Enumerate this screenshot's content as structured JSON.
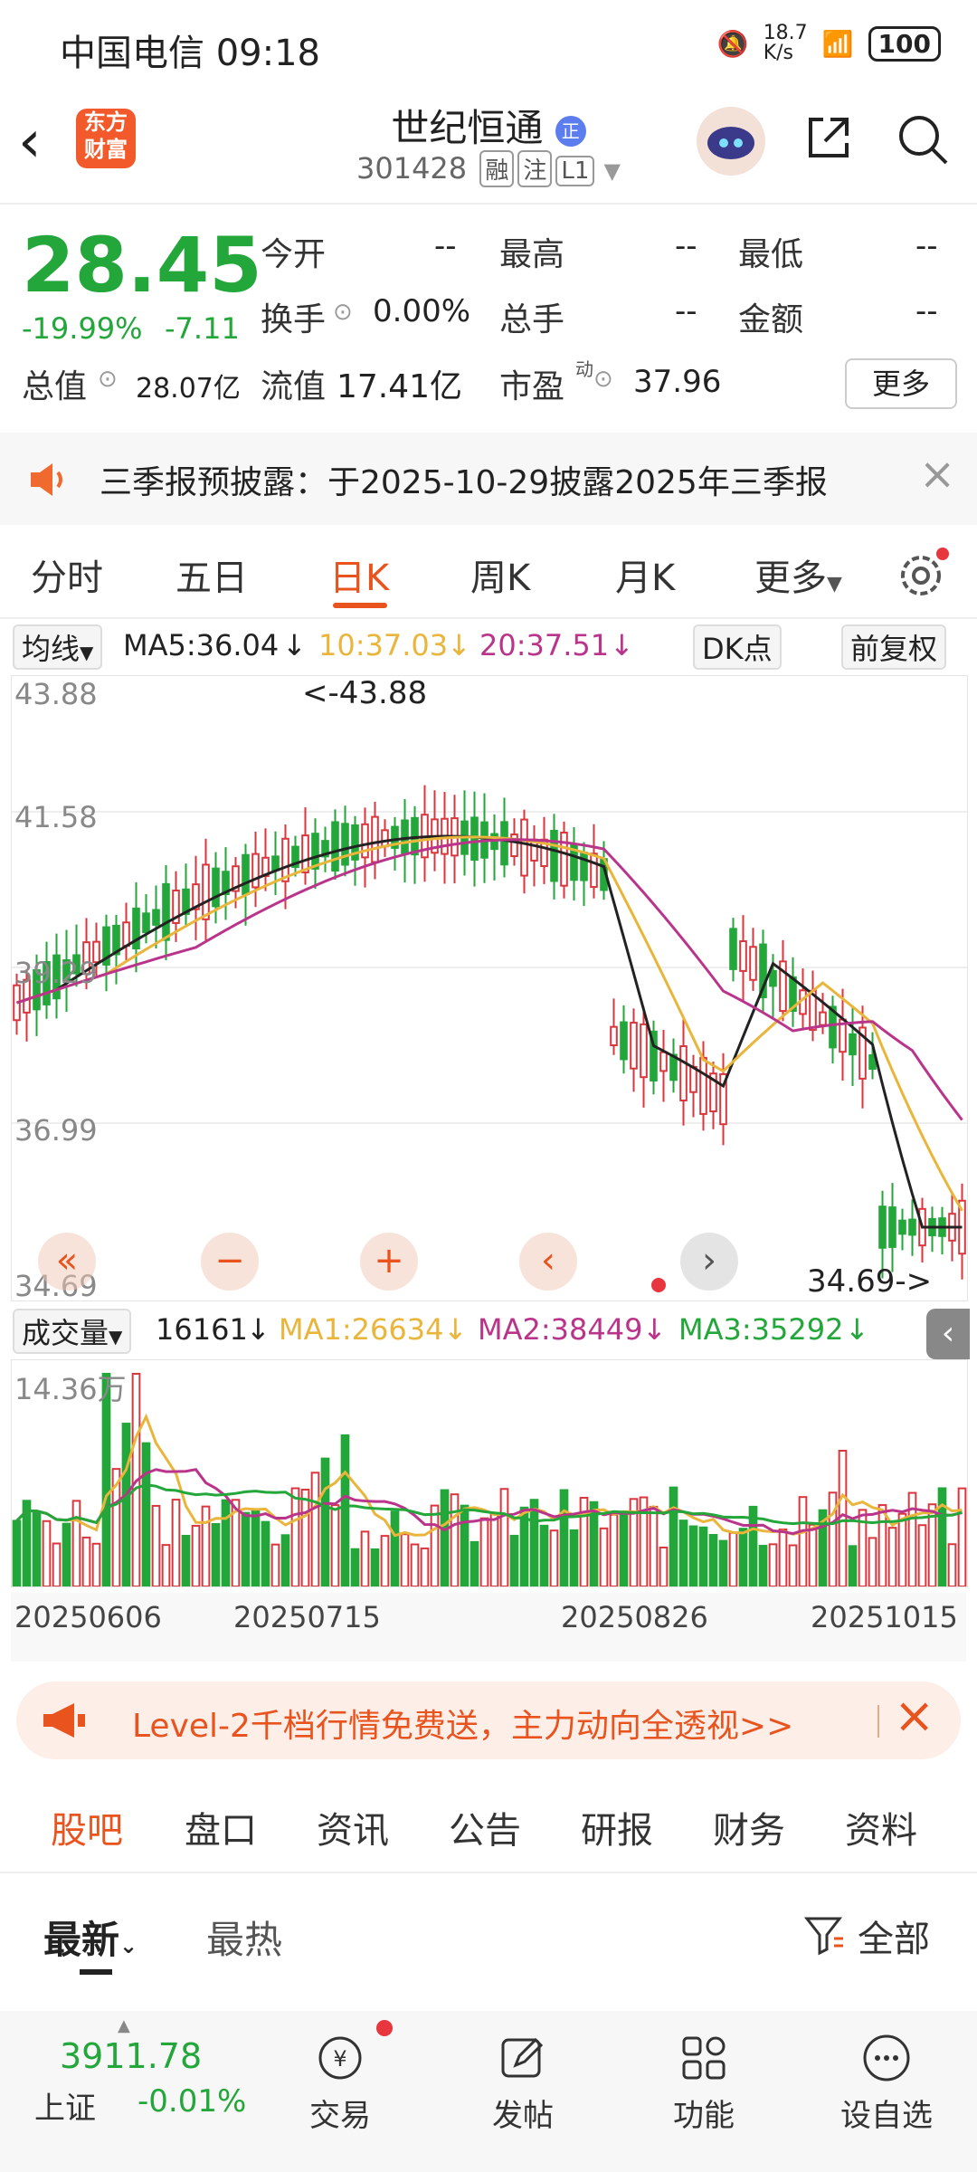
{
  "status_bar": {
    "carrier_time": "中国电信 09:18",
    "net_speed": "18.7\nK/s",
    "battery": "100"
  },
  "header": {
    "logo_text": "东方\n财富",
    "stock_name": "世纪恒通",
    "badge": "正",
    "stock_code": "301428",
    "tags": [
      "融",
      "注",
      "L1"
    ]
  },
  "quote": {
    "price": "28.45",
    "change_pct": "-19.99%",
    "change": "-7.11",
    "fields": [
      {
        "label": "今开",
        "value": "--"
      },
      {
        "label": "最高",
        "value": "--"
      },
      {
        "label": "最低",
        "value": "--"
      },
      {
        "label": "换手",
        "value": "0.00%"
      },
      {
        "label": "总手",
        "value": "--"
      },
      {
        "label": "金额",
        "value": "--"
      }
    ],
    "market_cap_label": "总值",
    "market_cap": "28.07亿",
    "float_cap_label": "流值",
    "float_cap": "17.41亿",
    "pe_label": "市盈",
    "pe_sup": "动",
    "pe": "37.96",
    "more": "更多"
  },
  "notice": {
    "text": "三季报预披露：于2025-10-29披露2025年三季报"
  },
  "chart_tabs": [
    "分时",
    "五日",
    "日K",
    "周K",
    "月K",
    "更多"
  ],
  "ma_bar": {
    "selector": "均线",
    "ma5": "MA5:36.04",
    "ma10": "10:37.03",
    "ma20": "20:37.51",
    "dk": "DK点",
    "adjust": "前复权"
  },
  "kline": {
    "y_labels": [
      "43.88",
      "41.58",
      "39.29",
      "36.99",
      "34.69"
    ],
    "high_annotation": "<-43.88",
    "low_annotation": "34.69->",
    "colors": {
      "up": "#d9363e",
      "down": "#23a63a",
      "ma5": "#222222",
      "ma10": "#e9b53a",
      "ma20": "#b9348a"
    }
  },
  "vol_bar": {
    "selector": "成交量",
    "vol": "16161",
    "ma1": "MA1:26634",
    "ma2": "MA2:38449",
    "ma3": "MA3:35292",
    "max_label": "14.36万"
  },
  "dates": [
    "20250606",
    "20250715",
    "20250826",
    "20251015"
  ],
  "level2": {
    "text": "Level-2千档行情免费送，主力动向全透视>>"
  },
  "sub_tabs": [
    "股吧",
    "盘口",
    "资讯",
    "公告",
    "研报",
    "财务",
    "资料"
  ],
  "filter": {
    "latest": "最新",
    "hot": "最热",
    "all": "全部"
  },
  "bottom_nav": {
    "index_value": "3911.78",
    "index_name": "上证",
    "index_change": "-0.01%",
    "items": [
      "交易",
      "发帖",
      "功能",
      "设自选"
    ]
  }
}
